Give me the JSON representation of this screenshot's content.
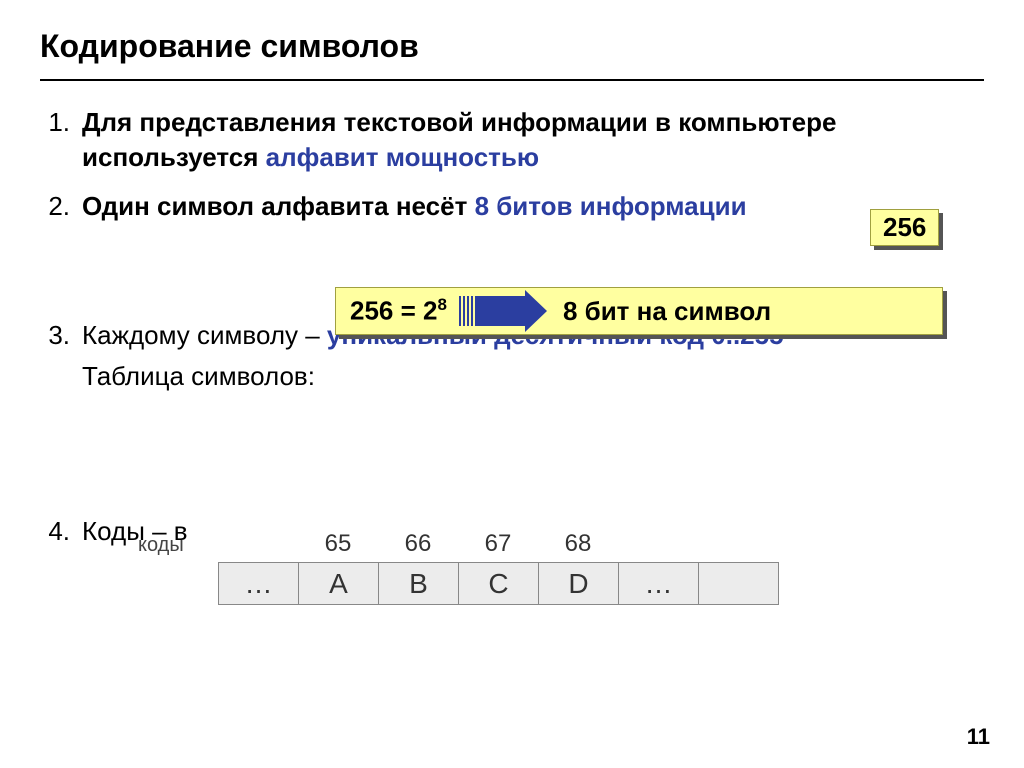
{
  "title": "Кодирование символов",
  "items": {
    "n1": "1.",
    "t1a": "Для представления текстовой информации  в компьютере используется ",
    "t1b": "алфавит мощностью",
    "n2": "2.",
    "t2a": "Один символ алфавита несёт ",
    "t2b": "8 битов информации",
    "n3": "3.",
    "t3a": " Каждому символу – ",
    "t3b": "уникальный десятичный код 0..255",
    "t3c": "Таблица символов:",
    "n4": "4.",
    "t4a": "Коды – в"
  },
  "badge256": "256",
  "callout": {
    "lhs_base": "256 = 2",
    "lhs_exp": "8",
    "rhs": "8 бит на символ"
  },
  "codes": {
    "label": "коды",
    "values": [
      "65",
      "66",
      "67",
      "68"
    ]
  },
  "symbols": [
    "…",
    "A",
    "B",
    "C",
    "D",
    "…",
    ""
  ],
  "page": "11"
}
